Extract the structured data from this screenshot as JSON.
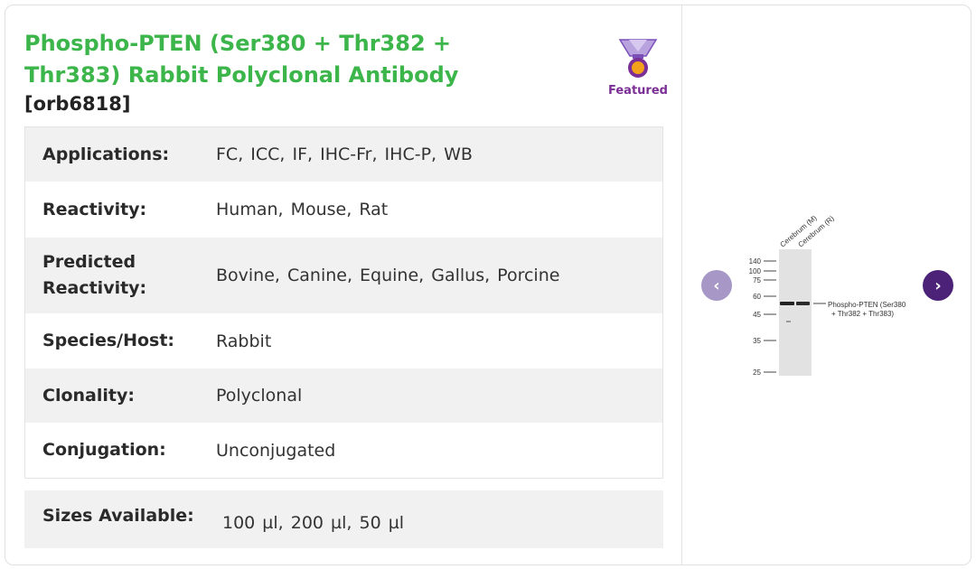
{
  "product": {
    "title": "Phospho-PTEN (Ser380 + Thr382 + Thr383) Rabbit Polyclonal Antibody",
    "sku": "[orb6818]",
    "featured_label": "Featured",
    "featured_icon": "medal-icon"
  },
  "specs": [
    {
      "label": "Applications:",
      "value": "FC,  ICC,  IF,  IHC-Fr,  IHC-P,  WB"
    },
    {
      "label": "Reactivity:",
      "value": "Human, Mouse, Rat"
    },
    {
      "label": "Predicted Reactivity:",
      "value": "Bovine, Canine, Equine, Gallus, Porcine"
    },
    {
      "label": "Species/Host:",
      "value": "Rabbit"
    },
    {
      "label": "Clonality:",
      "value": "Polyclonal"
    },
    {
      "label": "Conjugation:",
      "value": "Unconjugated"
    }
  ],
  "sizes": {
    "label": "Sizes Available:",
    "value": "100 µl, 200 µl, 50 µl"
  },
  "gallery": {
    "prev_icon": "chevron-left-icon",
    "next_icon": "chevron-right-icon",
    "prev_symbol": "‹",
    "next_symbol": "›",
    "blot": {
      "lanes": [
        "Cerebrum (M)",
        "Cerebrum (R)"
      ],
      "markers": [
        "140",
        "100",
        "75",
        "60",
        "45",
        "35",
        "25"
      ],
      "band_label_1": "Phospho-PTEN (Ser380",
      "band_label_2": "+ Thr382 + Thr383)"
    }
  },
  "colors": {
    "title": "#3cb54a",
    "featured": "#7b2e95",
    "prev_button": "#a697c6",
    "next_button": "#4b2278"
  }
}
